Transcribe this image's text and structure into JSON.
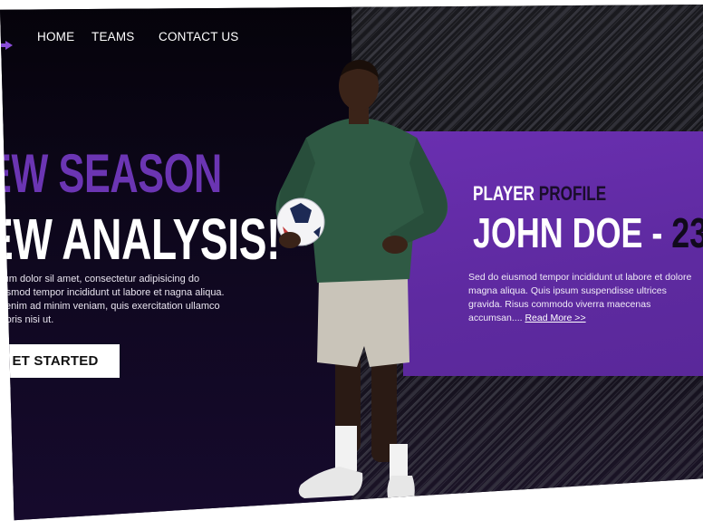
{
  "nav": {
    "items": [
      "HOME",
      "TEAMS",
      "CONTACT US"
    ]
  },
  "hero": {
    "title_line1": "EW SEASON",
    "title_line2": "EW ANALYSIS!",
    "paragraph": "psum dolor sil amet, consectetur adipisicing do eiusmod tempor incididunt ut labore et nagna aliqua. Ut enim ad minim veniam, quis exercitation ullamco laboris nisi ut.",
    "cta_label": "ET STARTED"
  },
  "profile": {
    "label_word1": "PLAYER",
    "label_word2": "PROFILE",
    "name": "JOHN DOE - ",
    "number": "23",
    "paragraph": "Sed do eiusmod tempor incididunt ut labore et dolore magna aliqua. Quis ipsum suspendisse ultrices gravida. Risus commodo viverra maecenas accumsan....",
    "read_more": "Read More >>"
  },
  "colors": {
    "accent_purple": "#6b35b3",
    "card_purple": "#5e2aa0",
    "background": "#0b0611"
  },
  "icons": {
    "nav_marker": "arrow-right-icon",
    "ball": "soccer-ball-icon"
  }
}
